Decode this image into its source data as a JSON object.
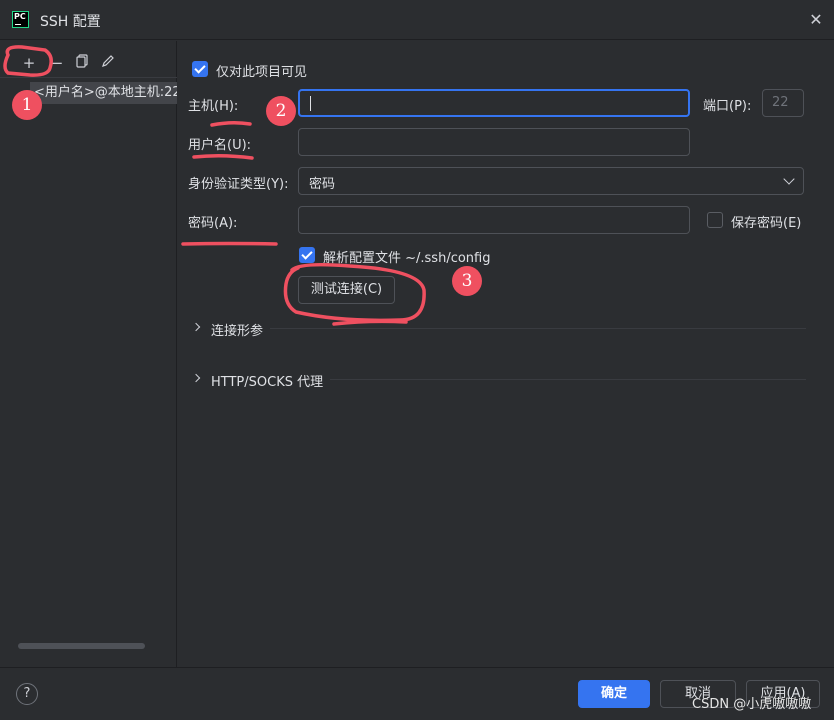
{
  "window": {
    "title": "SSH 配置",
    "close_icon": "close-icon"
  },
  "left_toolbar": {
    "add": "+",
    "remove": "−",
    "copy_icon": "copy-icon",
    "edit_icon": "edit-icon"
  },
  "config_list": {
    "items": [
      {
        "label": "<用户名>@本地主机:22"
      }
    ]
  },
  "form": {
    "visible_only_label": "仅对此项目可见",
    "visible_only_checked": true,
    "host_label": "主机(H):",
    "host_value": "",
    "port_label": "端口(P):",
    "port_value": "22",
    "user_label": "用户名(U):",
    "user_value": "",
    "auth_label": "身份验证类型(Y):",
    "auth_value": "密码",
    "password_label": "密码(A):",
    "password_value": "",
    "save_password_label": "保存密码(E)",
    "save_password_checked": false,
    "parse_config_label": "解析配置文件 ~/.ssh/config",
    "parse_config_checked": true,
    "test_connection_label": "测试连接(C)"
  },
  "sections": [
    {
      "label": "连接形参",
      "expanded": false
    },
    {
      "label": "HTTP/SOCKS 代理",
      "expanded": false
    }
  ],
  "footer": {
    "ok_label": "确定",
    "cancel_label": "取消",
    "apply_label": "应用(A)",
    "help": "?"
  },
  "annotations": {
    "badge1": "1",
    "badge2": "2",
    "badge3": "3"
  },
  "watermark": "CSDN @小虎嗷嗷嗷",
  "colors": {
    "accent": "#3574f0",
    "annotation": "#ef5060",
    "background": "#2b2d30"
  }
}
